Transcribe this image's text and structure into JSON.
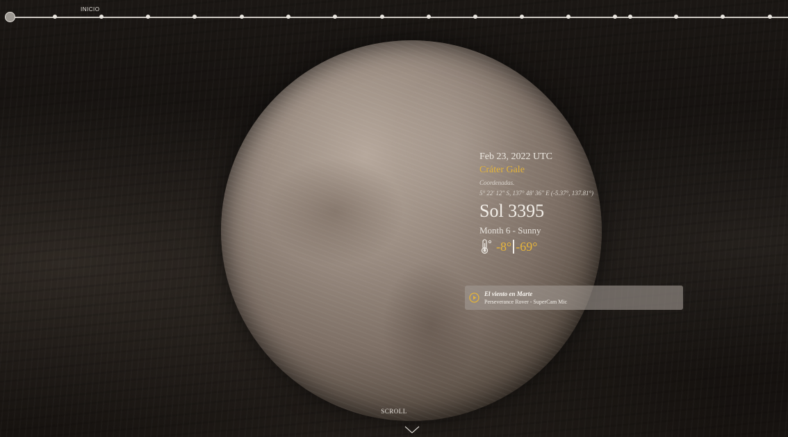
{
  "timeline": {
    "label": "INICIO",
    "dot_count": 18
  },
  "info": {
    "date": "Feb 23, 2022 UTC",
    "site": "Cráter Gale",
    "coords_label": "Coordenadas.",
    "coords": "5° 22' 12\" S, 137° 48' 36\" E (-5.37°, 137.81°)",
    "sol": "Sol 3395",
    "month": "Month 6 - Sunny",
    "temp_high": "-8°",
    "temp_low": "-69°"
  },
  "audio": {
    "title": "El viento en Marte",
    "subtitle": "Perseverance Rover - SuperCam Mic"
  },
  "scroll": {
    "label": "SCROLL"
  },
  "colors": {
    "accent": "#e3b33a",
    "text": "#eeeae4",
    "background": "#120f0d"
  },
  "icons": [
    "thermometer-icon",
    "play-icon",
    "chevron-down-icon"
  ]
}
